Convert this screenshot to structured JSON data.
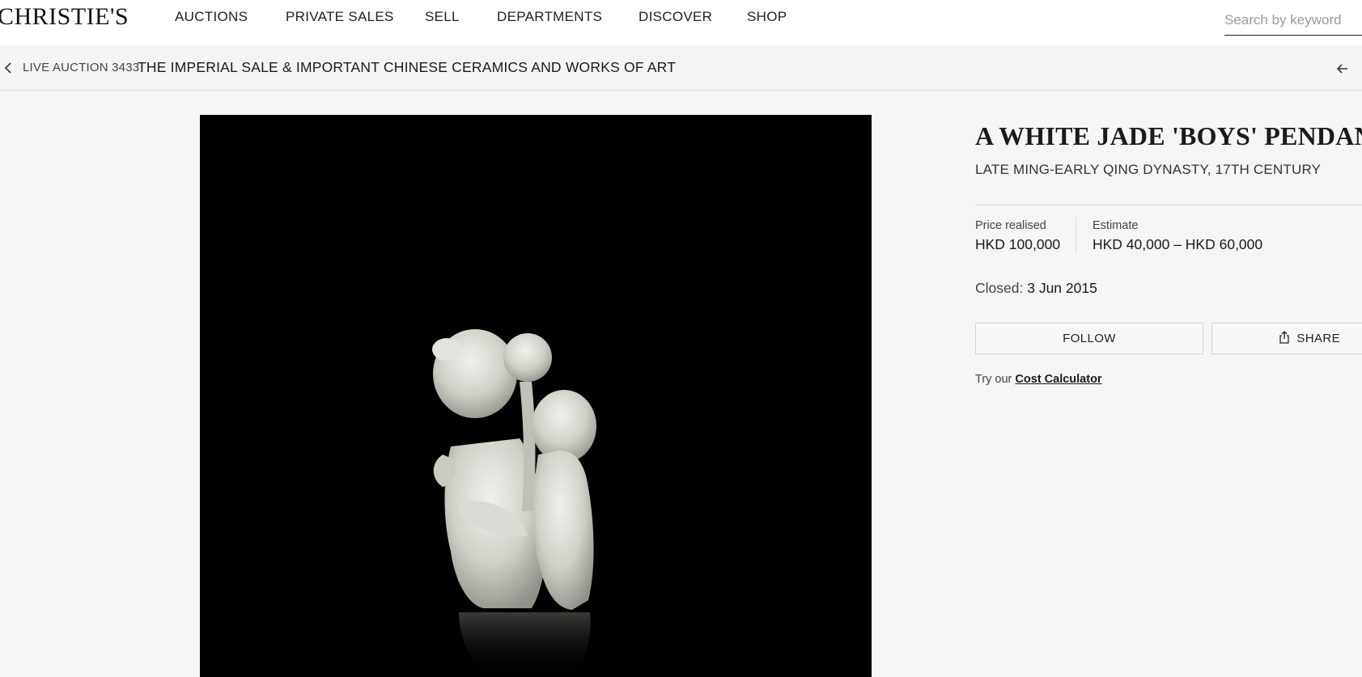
{
  "header": {
    "logo": "CHRISTIE'S",
    "nav": [
      "AUCTIONS",
      "PRIVATE SALES",
      "SELL",
      "DEPARTMENTS",
      "DISCOVER",
      "SHOP"
    ],
    "search_placeholder": "Search by keyword"
  },
  "breadcrumb": {
    "prefix": "LIVE AUCTION 3433",
    "title": "THE IMPERIAL SALE & IMPORTANT CHINESE CERAMICS AND WORKS OF ART"
  },
  "lot": {
    "title": "A WHITE JADE 'BOYS' PENDANT",
    "subtitle": "LATE MING-EARLY QING DYNASTY, 17TH CENTURY",
    "price_label": "Price realised",
    "price_value": "HKD 100,000",
    "estimate_label": "Estimate",
    "estimate_value": "HKD 40,000 – HKD 60,000",
    "closed_label": "Closed:",
    "closed_date": "3 Jun 2015",
    "follow_label": "FOLLOW",
    "share_label": "SHARE",
    "cost_prefix": "Try our",
    "cost_link": "Cost Calculator"
  },
  "colors": {
    "background": "#f5f5f5",
    "header_bg": "#ffffff",
    "image_bg": "#000000",
    "text": "#1a1a1a"
  },
  "icons": [
    "chevron-left-icon",
    "arrow-left-icon",
    "share-icon"
  ]
}
